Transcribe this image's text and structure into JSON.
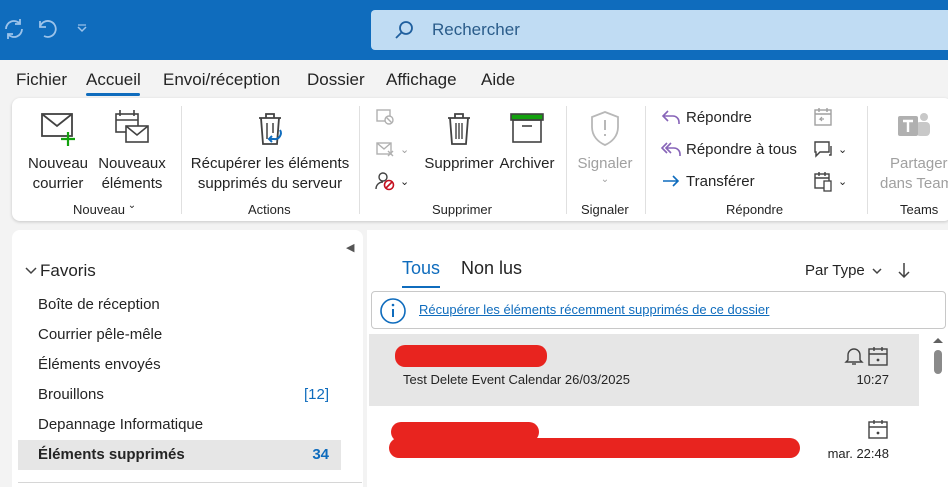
{
  "search": {
    "placeholder": "Rechercher"
  },
  "menu": [
    "Fichier",
    "Accueil",
    "Envoi/réception",
    "Dossier",
    "Affichage",
    "Aide"
  ],
  "ribbon": {
    "nouveau": {
      "new_mail": [
        "Nouveau",
        "courrier"
      ],
      "new_items": [
        "Nouveaux",
        "éléments"
      ],
      "label": "Nouveau"
    },
    "actions": {
      "recover": [
        "Récupérer les éléments",
        "supprimés du serveur"
      ],
      "label": "Actions"
    },
    "supprimer": {
      "delete": "Supprimer",
      "archive": "Archiver",
      "label": "Supprimer"
    },
    "signaler": {
      "report": "Signaler",
      "label": "Signaler"
    },
    "repondre": {
      "reply": "Répondre",
      "reply_all": "Répondre à tous",
      "forward": "Transférer",
      "label": "Répondre"
    },
    "teams": {
      "share": [
        "Partager",
        "dans Teams"
      ],
      "label": "Teams"
    }
  },
  "folders": {
    "favorites_label": "Favoris",
    "items": [
      {
        "name": "Boîte de réception",
        "count": ""
      },
      {
        "name": "Courrier pêle-mêle",
        "count": ""
      },
      {
        "name": "Éléments envoyés",
        "count": ""
      },
      {
        "name": "Brouillons",
        "count": "[12]"
      },
      {
        "name": "Depannage Informatique",
        "count": ""
      },
      {
        "name": "Éléments supprimés",
        "count": "34"
      }
    ]
  },
  "list": {
    "tabs": [
      "Tous",
      "Non lus"
    ],
    "sort_label": "Par Type",
    "info_link": "Récupérer les éléments récemment supprimés de ce dossier",
    "messages": [
      {
        "subject": "Test Delete Event Calendar 26/03/2025",
        "time": "10:27"
      },
      {
        "subject": "",
        "time": "mar. 22:48"
      }
    ]
  },
  "colors": {
    "accent": "#0f6cbd",
    "redaction": "#e8241f"
  }
}
